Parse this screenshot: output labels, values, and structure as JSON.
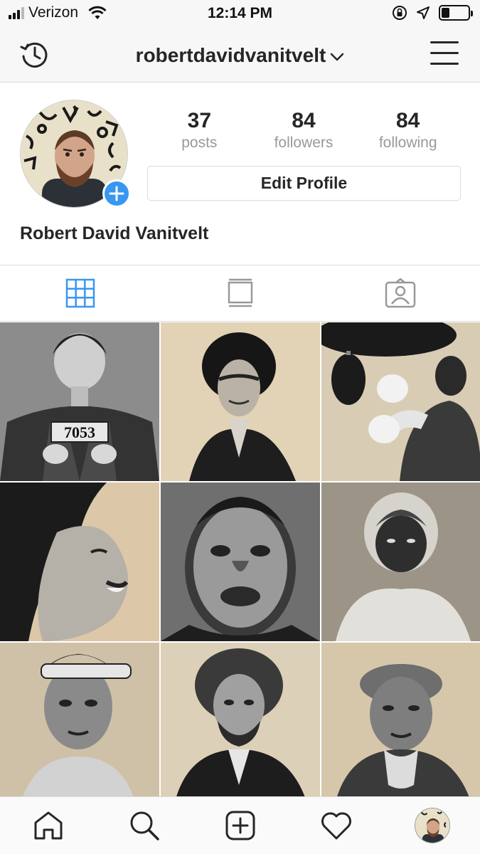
{
  "status_bar": {
    "carrier": "Verizon",
    "time": "12:14 PM",
    "battery_level": 0.3,
    "icons": [
      "signal-icon",
      "wifi-icon",
      "rotation-lock-icon",
      "location-arrow-icon",
      "battery-icon"
    ]
  },
  "header": {
    "username": "robertdavidvanitvelt",
    "icons": [
      "history-icon",
      "chevron-down-icon",
      "menu-icon"
    ]
  },
  "profile": {
    "full_name": "Robert David Vanitvelt",
    "edit_profile_label": "Edit Profile",
    "stats": [
      {
        "value": "37",
        "label": "posts"
      },
      {
        "value": "84",
        "label": "followers"
      },
      {
        "value": "84",
        "label": "following"
      }
    ]
  },
  "tabs": [
    {
      "name": "grid-view-icon",
      "active": true
    },
    {
      "name": "list-view-icon",
      "active": false
    },
    {
      "name": "tagged-photos-icon",
      "active": false
    }
  ],
  "posts": [
    {
      "caption": "7053"
    },
    {
      "caption": ""
    },
    {
      "caption": ""
    },
    {
      "caption": ""
    },
    {
      "caption": ""
    },
    {
      "caption": ""
    },
    {
      "caption": ""
    },
    {
      "caption": ""
    },
    {
      "caption": ""
    }
  ],
  "bottom_nav": [
    "home-icon",
    "search-icon",
    "new-post-icon",
    "activity-heart-icon",
    "profile-avatar"
  ],
  "colors": {
    "accent_blue": "#3897f0",
    "text": "#262626",
    "muted": "#999999",
    "border": "#dbdbdb",
    "bar_bg": "#f7f7f7"
  }
}
